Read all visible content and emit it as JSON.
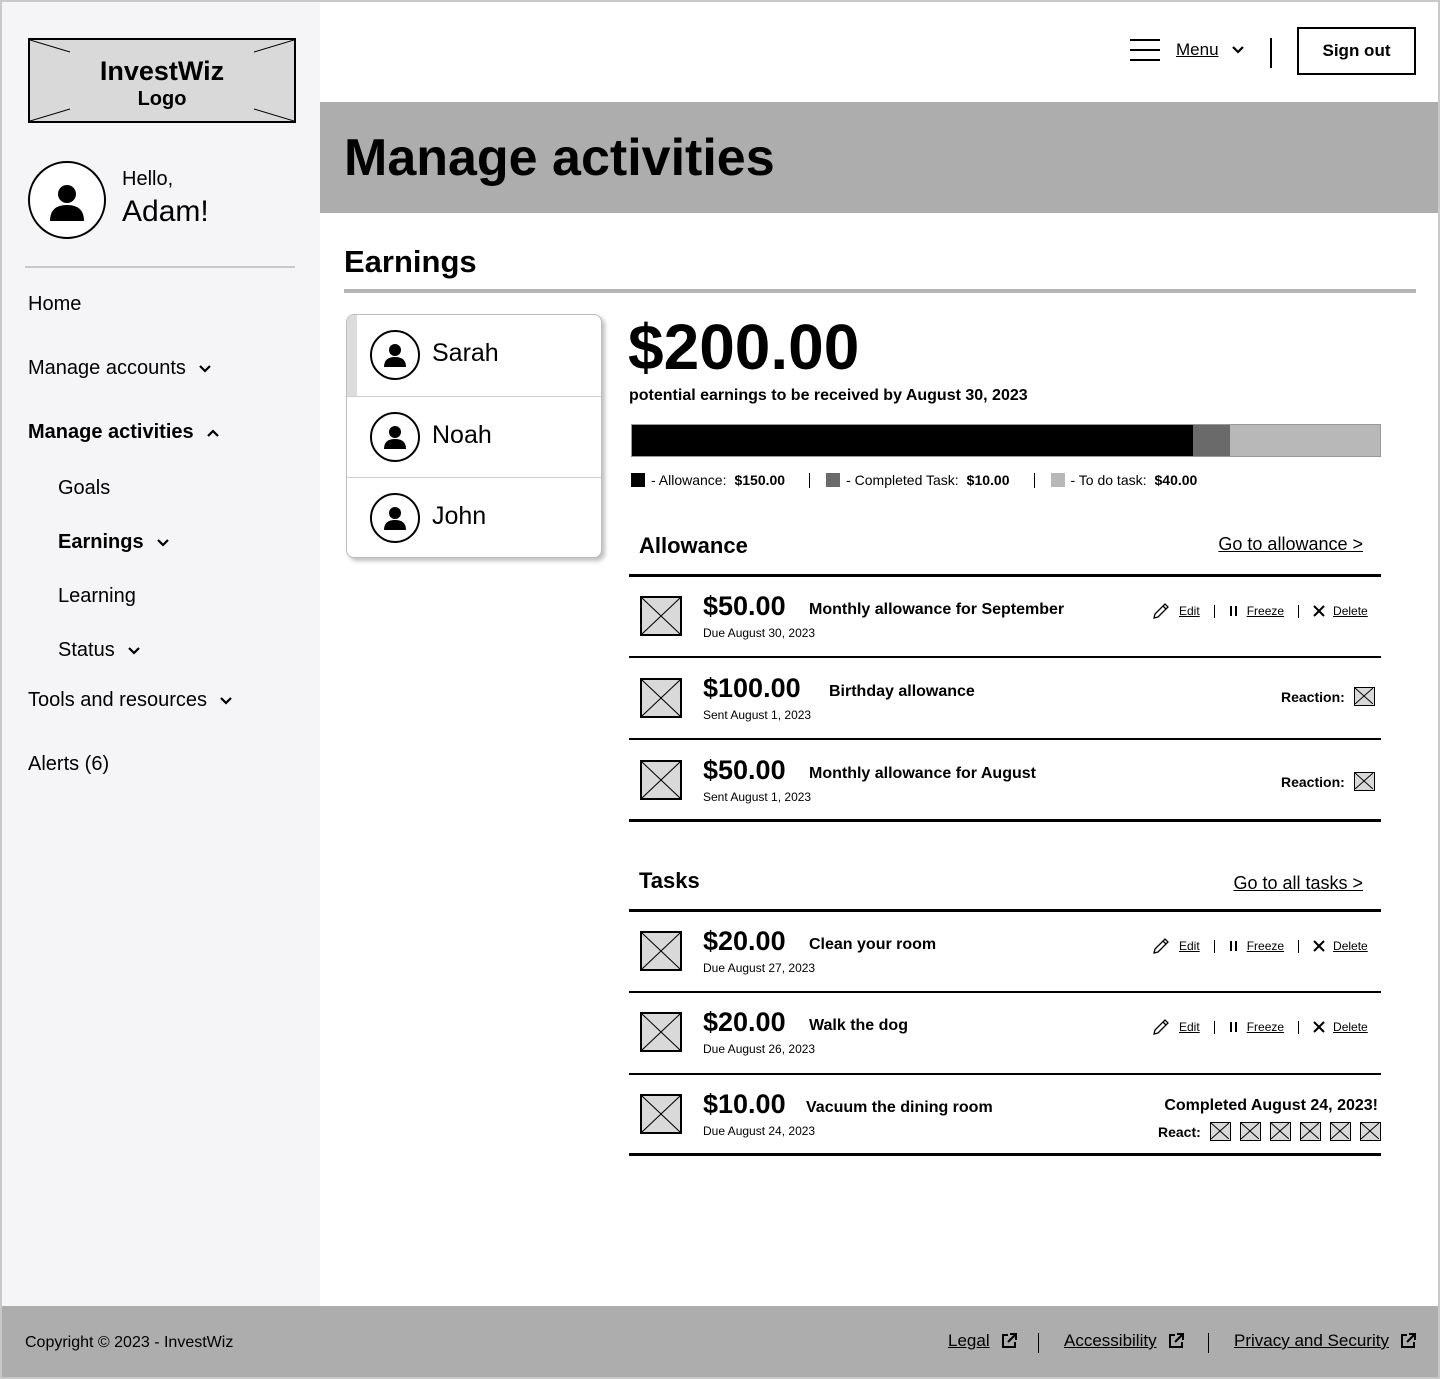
{
  "logo": {
    "name": "InvestWiz",
    "sub": "Logo"
  },
  "greeting": {
    "hello": "Hello,",
    "name": "Adam!"
  },
  "nav": {
    "home": "Home",
    "manage_accounts": "Manage accounts",
    "manage_activities": "Manage activities",
    "goals": "Goals",
    "earnings": "Earnings",
    "learning": "Learning",
    "status": "Status",
    "tools": "Tools and resources",
    "alerts": "Alerts (6)"
  },
  "topbar": {
    "menu": "Menu",
    "sign_out": "Sign out"
  },
  "page": {
    "title": "Manage activities",
    "section": "Earnings"
  },
  "kids": [
    {
      "name": "Sarah",
      "active": true
    },
    {
      "name": "Noah",
      "active": false
    },
    {
      "name": "John",
      "active": false
    }
  ],
  "summary": {
    "amount": "$200.00",
    "subtitle": "potential earnings to be received by August 30, 2023",
    "bar": [
      {
        "label": "Allowance",
        "value": 150,
        "color": "#000000"
      },
      {
        "label": "Completed Task",
        "value": 10,
        "color": "#6a6a6a"
      },
      {
        "label": "To do task",
        "value": 40,
        "color": "#b8b8b8"
      }
    ],
    "legend": [
      {
        "label": "- Allowance:",
        "value": "$150.00"
      },
      {
        "label": "- Completed Task:",
        "value": "$10.00"
      },
      {
        "label": "- To do task:",
        "value": "$40.00"
      }
    ]
  },
  "allowance": {
    "heading": "Allowance",
    "link": "Go to allowance >",
    "items": [
      {
        "amount": "$50.00",
        "title": "Monthly allowance for September",
        "date": "Due August 30, 2023"
      },
      {
        "amount": "$100.00",
        "title": "Birthday allowance",
        "date": "Sent August 1, 2023"
      },
      {
        "amount": "$50.00",
        "title": "Monthly allowance for August",
        "date": "Sent August 1, 2023"
      }
    ]
  },
  "tasks": {
    "heading": "Tasks",
    "link": "Go to all tasks >",
    "items": [
      {
        "amount": "$20.00",
        "title": "Clean your room",
        "date": "Due August 27, 2023"
      },
      {
        "amount": "$20.00",
        "title": "Walk the dog",
        "date": "Due August 26, 2023"
      },
      {
        "amount": "$10.00",
        "title": "Vacuum the dining room",
        "date": "Due August 24, 2023"
      }
    ],
    "completed": "Completed August 24, 2023!"
  },
  "actions": {
    "edit": "Edit",
    "freeze": "Freeze",
    "delete": "Delete",
    "reaction": "Reaction:",
    "react": "React:"
  },
  "footer": {
    "copyright": "Copyright © 2023 - InvestWiz",
    "legal": "Legal",
    "accessibility": "Accessibility",
    "privacy": "Privacy and Security"
  },
  "icons": [
    "menu-icon",
    "chevron-down-icon",
    "chevron-up-icon",
    "user-icon",
    "pencil-icon",
    "pause-icon",
    "close-icon",
    "image-placeholder-icon",
    "external-link-icon"
  ]
}
